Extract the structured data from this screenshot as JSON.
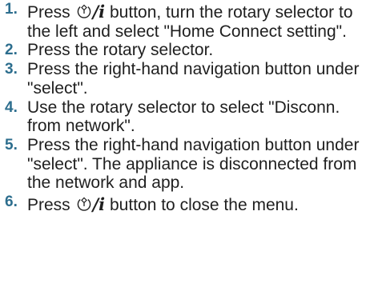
{
  "steps": [
    {
      "number": "1.",
      "before": "Press ",
      "button_symbol": "/i",
      "after": " button, turn the rotary selector to the left and select \"Home Connect setting\".",
      "icon": "power-info-icon"
    },
    {
      "number": "2.",
      "text": "Press the rotary selector."
    },
    {
      "number": "3.",
      "text": "Press the right-hand navigation button under \"select\"."
    },
    {
      "number": "4.",
      "text": "Use the rotary selector to select \"Disconn. from network\"."
    },
    {
      "number": "5.",
      "text": "Press the right-hand navigation button under \"select\". The appliance is disconnected from the network and app."
    },
    {
      "number": "6.",
      "before": "Press ",
      "button_symbol": "/i",
      "after": " button to close the menu.",
      "icon": "power-info-icon"
    }
  ],
  "colors": {
    "text": "#1f1f1f",
    "step_number": "#2d6e8e"
  }
}
